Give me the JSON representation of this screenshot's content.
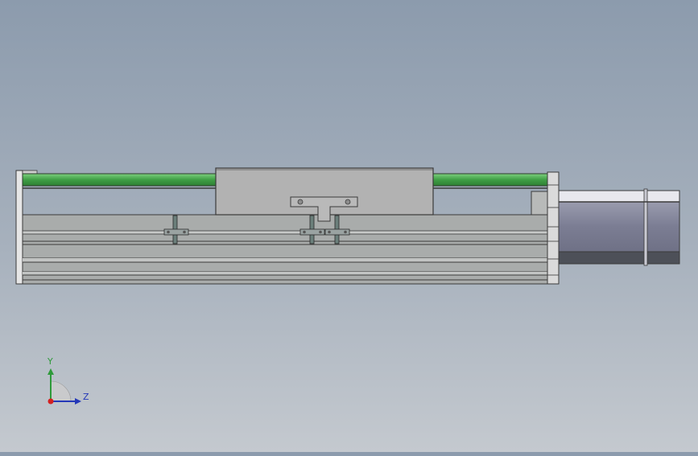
{
  "axis_triad": {
    "y_label": "Y",
    "z_label": "Z",
    "y_color": "#2e9a3a",
    "z_color": "#2438b8",
    "x_color": "#d42020"
  },
  "colors": {
    "rail_green": "#4caf50",
    "body_gray": "#a9acab",
    "carriage_gray": "#b2b2b2",
    "motor_blue_gray": "#7e8096",
    "outline": "#3a3a3a"
  }
}
